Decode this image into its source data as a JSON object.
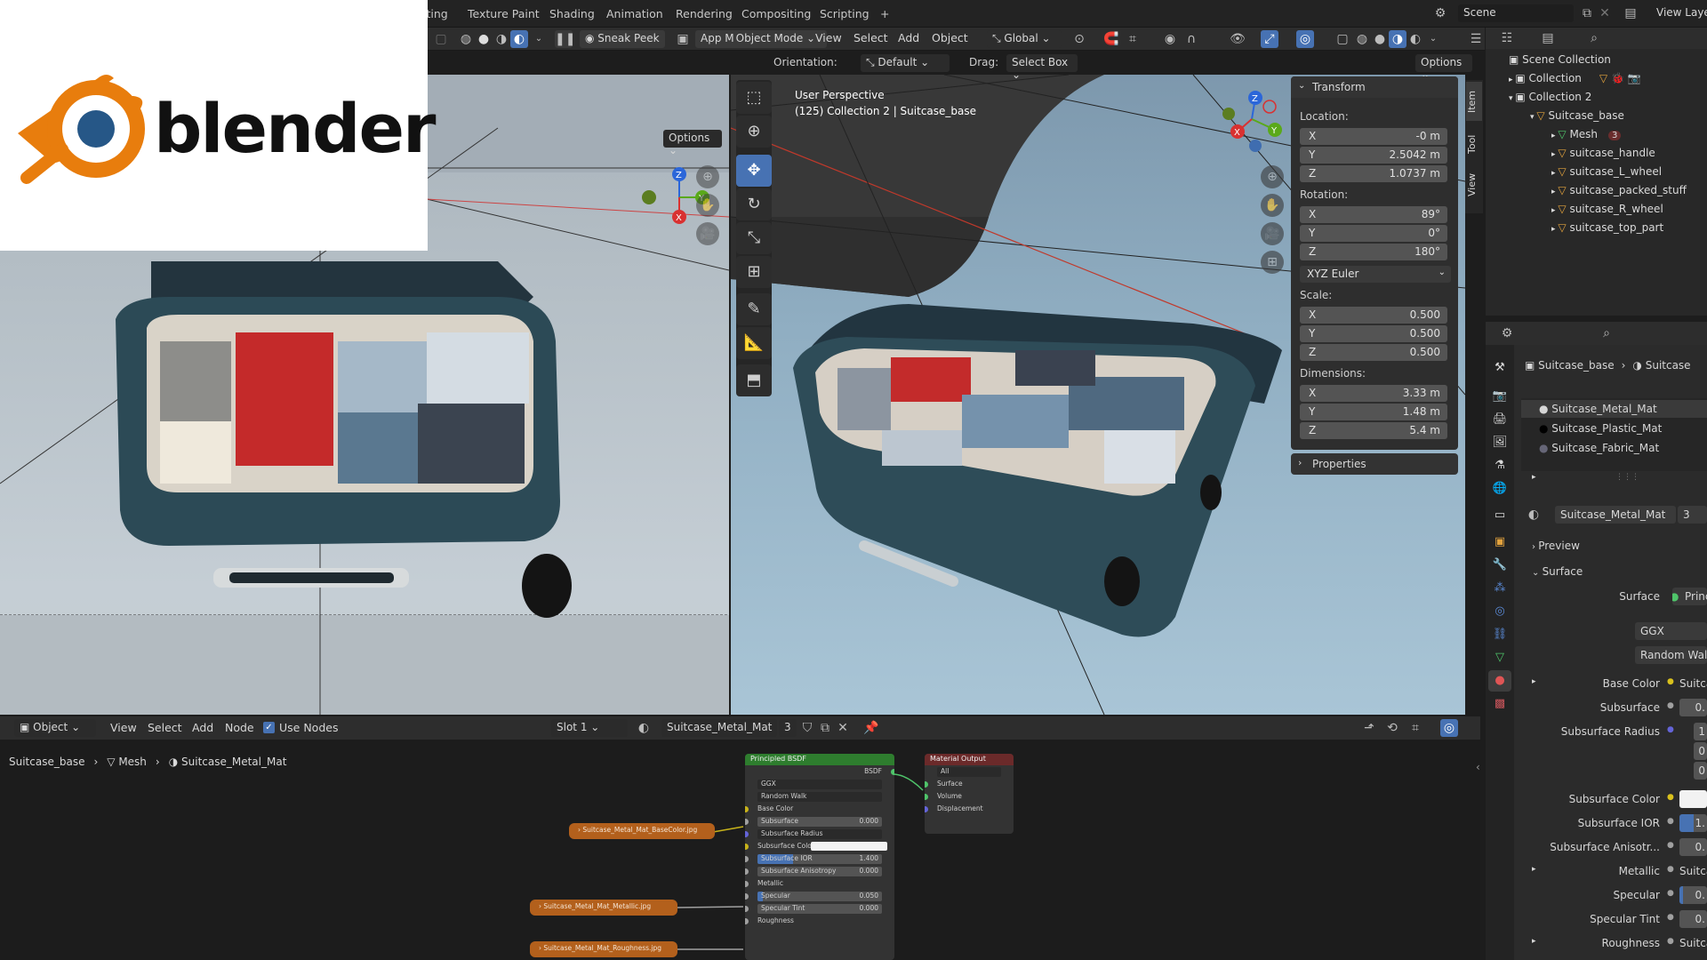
{
  "workspace_tabs": [
    "iting",
    "Texture Paint",
    "Shading",
    "Animation",
    "Rendering",
    "Compositing",
    "Scripting",
    "+"
  ],
  "scene": {
    "name": "Scene",
    "view_layer": "View Laye"
  },
  "left_header": {
    "preview_label": "Sneak Peek"
  },
  "right_header": {
    "mode_label": "Object Mode",
    "app_label": "App M",
    "menus": [
      "View",
      "Select",
      "Add",
      "Object"
    ],
    "transform_space": "Global"
  },
  "tool_header": {
    "orientation_label": "Orientation:",
    "orientation_value": "Default",
    "drag_label": "Drag:",
    "drag_value": "Select Box",
    "options": "Options"
  },
  "left_options": "Options",
  "viewport_overlay": {
    "line1": "User Perspective",
    "line2": "(125) Collection 2 | Suitcase_base"
  },
  "side_tabs": [
    "Item",
    "Tool",
    "View"
  ],
  "npanel": {
    "transform_title": "Transform",
    "location_label": "Location:",
    "location": [
      {
        "axis": "X",
        "value": "-0 m"
      },
      {
        "axis": "Y",
        "value": "2.5042 m"
      },
      {
        "axis": "Z",
        "value": "1.0737 m"
      }
    ],
    "rotation_label": "Rotation:",
    "rotation": [
      {
        "axis": "X",
        "value": "89°"
      },
      {
        "axis": "Y",
        "value": "0°"
      },
      {
        "axis": "Z",
        "value": "180°"
      }
    ],
    "rotation_mode": "XYZ Euler",
    "scale_label": "Scale:",
    "scale": [
      {
        "axis": "X",
        "value": "0.500"
      },
      {
        "axis": "Y",
        "value": "0.500"
      },
      {
        "axis": "Z",
        "value": "0.500"
      }
    ],
    "dimensions_label": "Dimensions:",
    "dimensions": [
      {
        "axis": "X",
        "value": "3.33 m"
      },
      {
        "axis": "Y",
        "value": "1.48 m"
      },
      {
        "axis": "Z",
        "value": "5.4 m"
      }
    ],
    "properties_title": "Properties"
  },
  "outliner": {
    "items": [
      {
        "label": "Scene Collection"
      },
      {
        "label": "Collection"
      },
      {
        "label": "Collection 2"
      },
      {
        "label": "Suitcase_base"
      },
      {
        "label": "Mesh"
      },
      {
        "label": "suitcase_handle"
      },
      {
        "label": "suitcase_L_wheel"
      },
      {
        "label": "suitcase_packed_stuff"
      },
      {
        "label": "suitcase_R_wheel"
      },
      {
        "label": "suitcase_top_part"
      }
    ],
    "mesh_badge": "3"
  },
  "properties": {
    "breadcrumb_object": "Suitcase_base",
    "breadcrumb_material": "Suitcase",
    "material_slots": [
      "Suitcase_Metal_Mat",
      "Suitcase_Plastic_Mat",
      "Suitcase_Fabric_Mat"
    ],
    "material_name": "Suitcase_Metal_Mat",
    "material_users": "3",
    "preview_label": "Preview",
    "surface_panel": "Surface",
    "surface_label": "Surface",
    "surface_value": "Principled B",
    "distribution": "GGX",
    "subsurface_method": "Random Walk",
    "rows": [
      {
        "label": "Base Color",
        "value": "Suitcase_M"
      },
      {
        "label": "Subsurface",
        "value": "0."
      },
      {
        "label": "Subsurface Radius",
        "value": "1"
      },
      {
        "label": "Subsurface Color",
        "value": ""
      },
      {
        "label": "Subsurface IOR",
        "value": "1."
      },
      {
        "label": "Subsurface Anisotr...",
        "value": "0."
      },
      {
        "label": "Metallic",
        "value": "Suitcase_M"
      },
      {
        "label": "Specular",
        "value": "0."
      },
      {
        "label": "Specular Tint",
        "value": "0."
      },
      {
        "label": "Roughness",
        "value": "Suitcase_M"
      }
    ],
    "radius_extra": [
      "0",
      "0"
    ]
  },
  "node_editor": {
    "header": {
      "object_mode": "Object",
      "menus": [
        "View",
        "Select",
        "Add",
        "Node"
      ],
      "use_nodes": "Use Nodes",
      "slot": "Slot 1",
      "material": "Suitcase_Metal_Mat",
      "users": "3"
    },
    "breadcrumb": [
      "Suitcase_base",
      "Mesh",
      "Suitcase_Metal_Mat"
    ],
    "bsdf": {
      "title": "Principled BSDF",
      "output": "BSDF",
      "distribution": "GGX",
      "subsurface_method": "Random Walk",
      "rows": [
        {
          "label": "Base Color",
          "value": ""
        },
        {
          "label": "Subsurface",
          "value": "0.000"
        },
        {
          "label": "Subsurface Radius",
          "value": ""
        },
        {
          "label": "Subsurface Color",
          "value": ""
        },
        {
          "label": "Subsurface IOR",
          "value": "1.400"
        },
        {
          "label": "Subsurface Anisotropy",
          "value": "0.000"
        },
        {
          "label": "Metallic",
          "value": ""
        },
        {
          "label": "Specular",
          "value": "0.050"
        },
        {
          "label": "Specular Tint",
          "value": "0.000"
        },
        {
          "label": "Roughness",
          "value": ""
        }
      ]
    },
    "output_node": {
      "title": "Material Output",
      "target": "All",
      "rows": [
        "Surface",
        "Volume",
        "Displacement"
      ]
    },
    "textures": [
      "Suitcase_Metal_Mat_BaseColor.jpg",
      "Suitcase_Metal_Mat_Metallic.jpg",
      "Suitcase_Metal_Mat_Roughness.jpg"
    ]
  },
  "logo": {
    "wordmark": "blender"
  },
  "colors": {
    "accent": "#4772b3",
    "logo_orange": "#e87d0d",
    "logo_blue": "#265787",
    "node_green": "#2e7d2e",
    "node_red": "#6b2a2a",
    "texture_node": "#b3601c"
  }
}
